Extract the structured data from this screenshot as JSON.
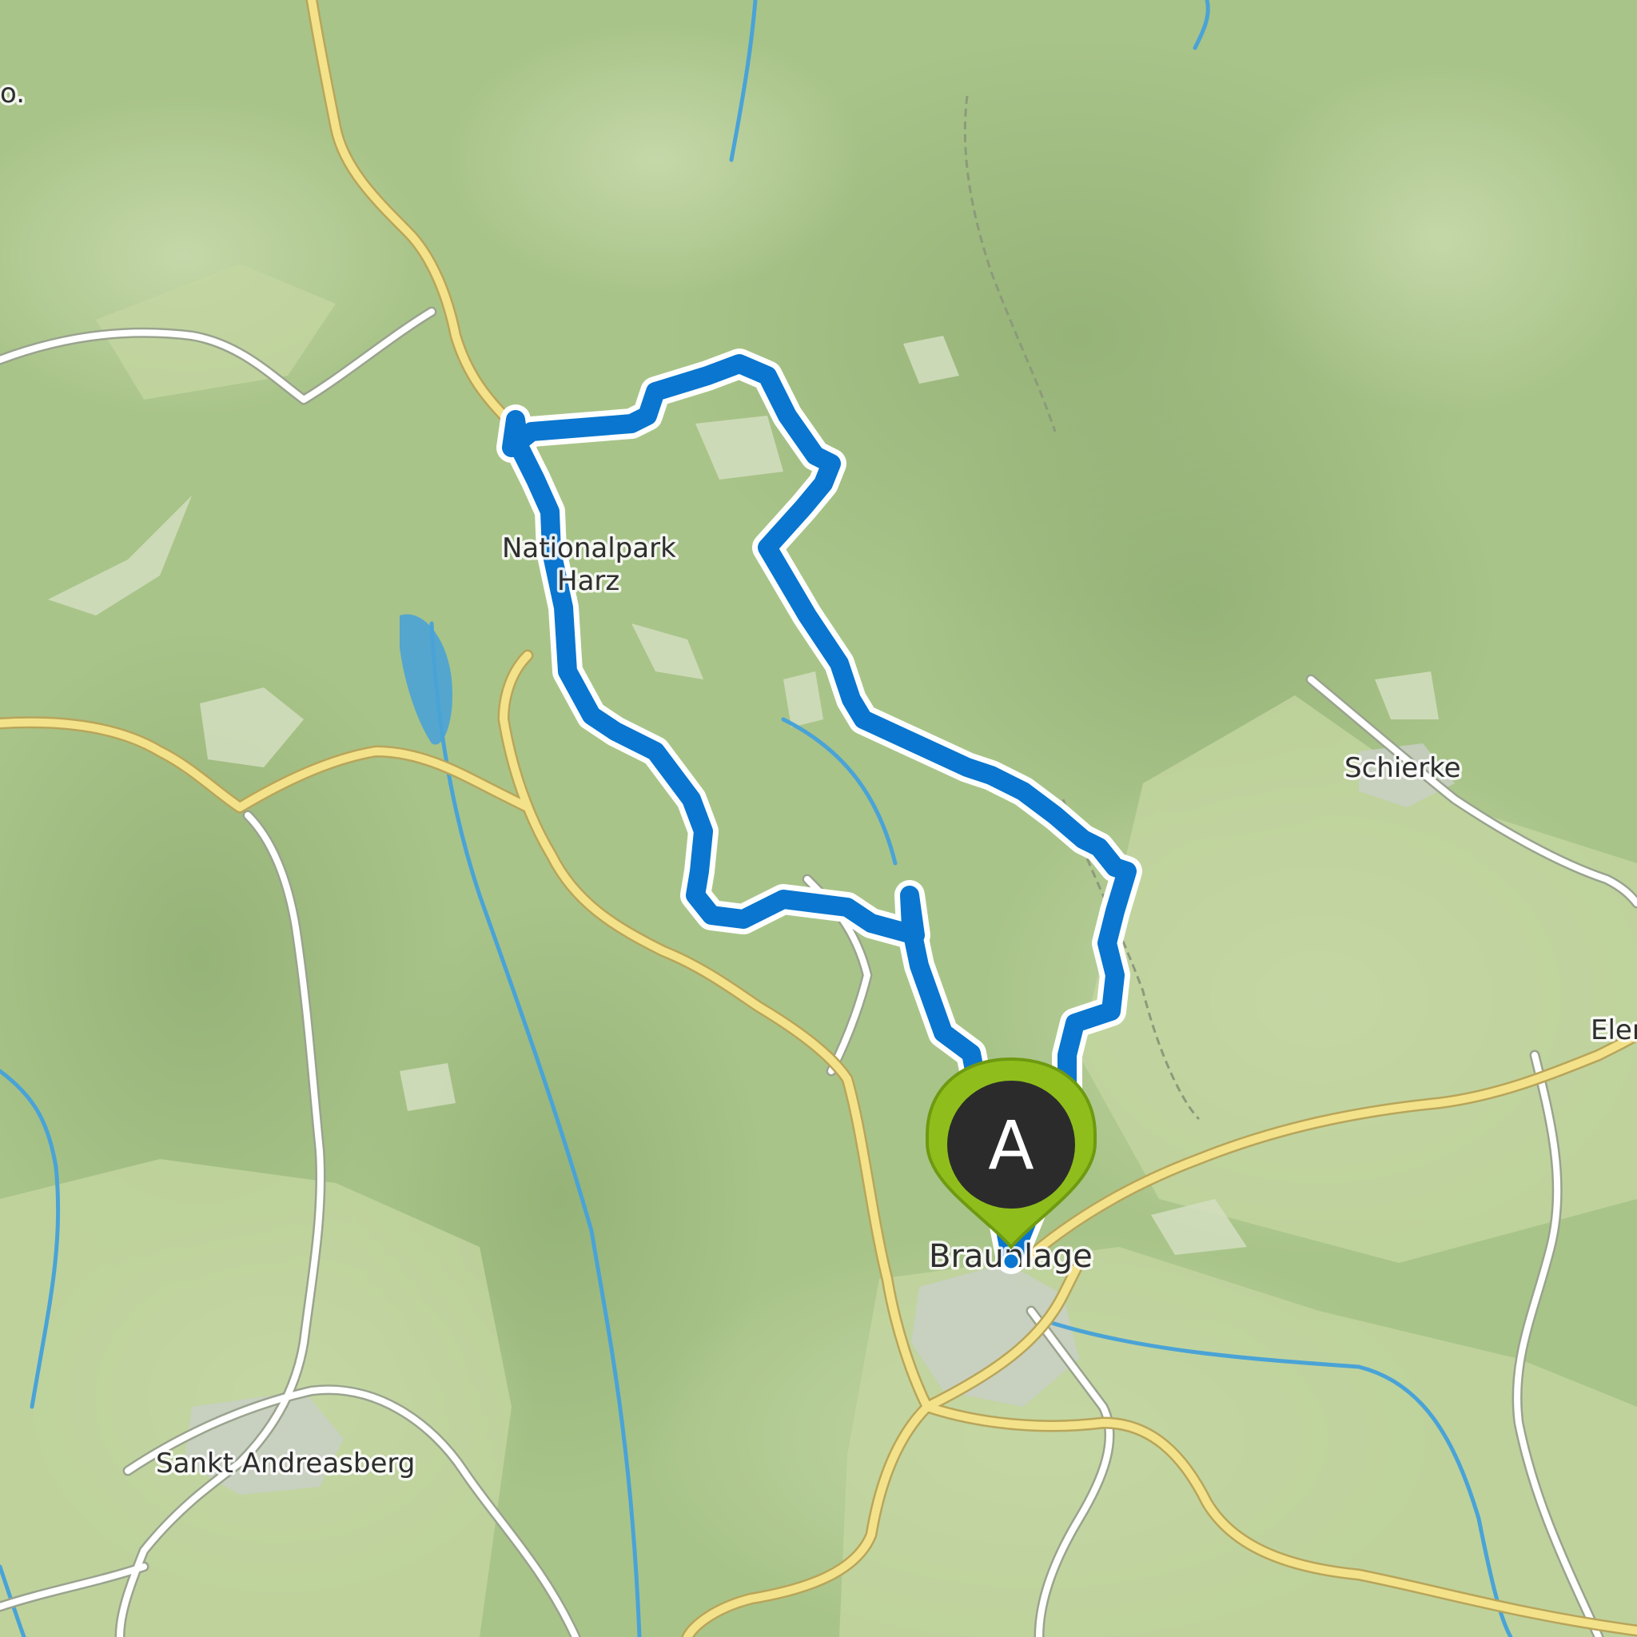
{
  "map": {
    "places": {
      "nationalpark": "Nationalpark Harz",
      "nationalpark_line1": "Nationalpark",
      "nationalpark_line2": "Harz",
      "schierke": "Schierke",
      "elend": "Elend",
      "braunlage": "Braunlage",
      "sankt_andreasberg": "Sankt Andreasberg",
      "edge_fragment": "o."
    },
    "start_marker": {
      "letter": "A"
    },
    "colors": {
      "terrain": "#a9c489",
      "forest": "#9cba7c",
      "open_land": "#c4d6a1",
      "clearing": "#d3dec0",
      "major_road": "#f3e28a",
      "minor_road": "#ffffff",
      "water": "#4aa3d6",
      "route": "#0a76cf",
      "marker": "#8fbe1c",
      "marker_inner": "#2b2b2b"
    }
  }
}
